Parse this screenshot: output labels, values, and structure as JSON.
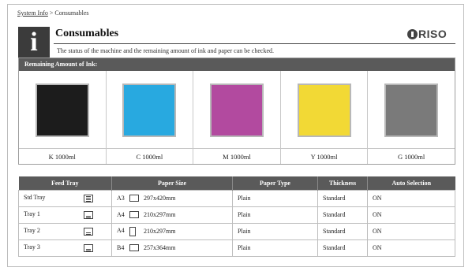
{
  "breadcrumb": {
    "parent": "System Info",
    "separator": ">",
    "current": "Consumables"
  },
  "info_icon": "i",
  "title": "Consumables",
  "description": "The status of the machine and the remaining amount of ink and paper can be checked.",
  "logo": "RISO",
  "ink": {
    "header": "Remaining Amount of Ink:",
    "items": [
      {
        "label": "K  1000ml",
        "color": "#1c1c1c",
        "level_percent": 100
      },
      {
        "label": "C  1000ml",
        "color": "#28a9e0",
        "level_percent": 100
      },
      {
        "label": "M 1000ml",
        "color": "#b24a9f",
        "level_percent": 100
      },
      {
        "label": "Y  1000ml",
        "color": "#f2d935",
        "level_percent": 100
      },
      {
        "label": "G  1000ml",
        "color": "#7a7a7a",
        "level_percent": 100
      }
    ]
  },
  "trays": {
    "headers": [
      "Feed Tray",
      "Paper Size",
      "Paper Type",
      "Thickness",
      "Auto Selection"
    ],
    "rows": [
      {
        "tray": "Std Tray",
        "tray_icon": "tray-full-icon",
        "size_code": "A3",
        "orientation": "landscape",
        "size": "297x420mm",
        "type": "Plain",
        "thickness": "Standard",
        "auto": "ON"
      },
      {
        "tray": "Tray 1",
        "tray_icon": "tray-icon",
        "size_code": "A4",
        "orientation": "landscape",
        "size": "210x297mm",
        "type": "Plain",
        "thickness": "Standard",
        "auto": "ON"
      },
      {
        "tray": "Tray 2",
        "tray_icon": "tray-icon",
        "size_code": "A4",
        "orientation": "portrait",
        "size": "210x297mm",
        "type": "Plain",
        "thickness": "Standard",
        "auto": "ON"
      },
      {
        "tray": "Tray 3",
        "tray_icon": "tray-icon",
        "size_code": "B4",
        "orientation": "landscape",
        "size": "257x364mm",
        "type": "Plain",
        "thickness": "Standard",
        "auto": "ON"
      }
    ]
  }
}
